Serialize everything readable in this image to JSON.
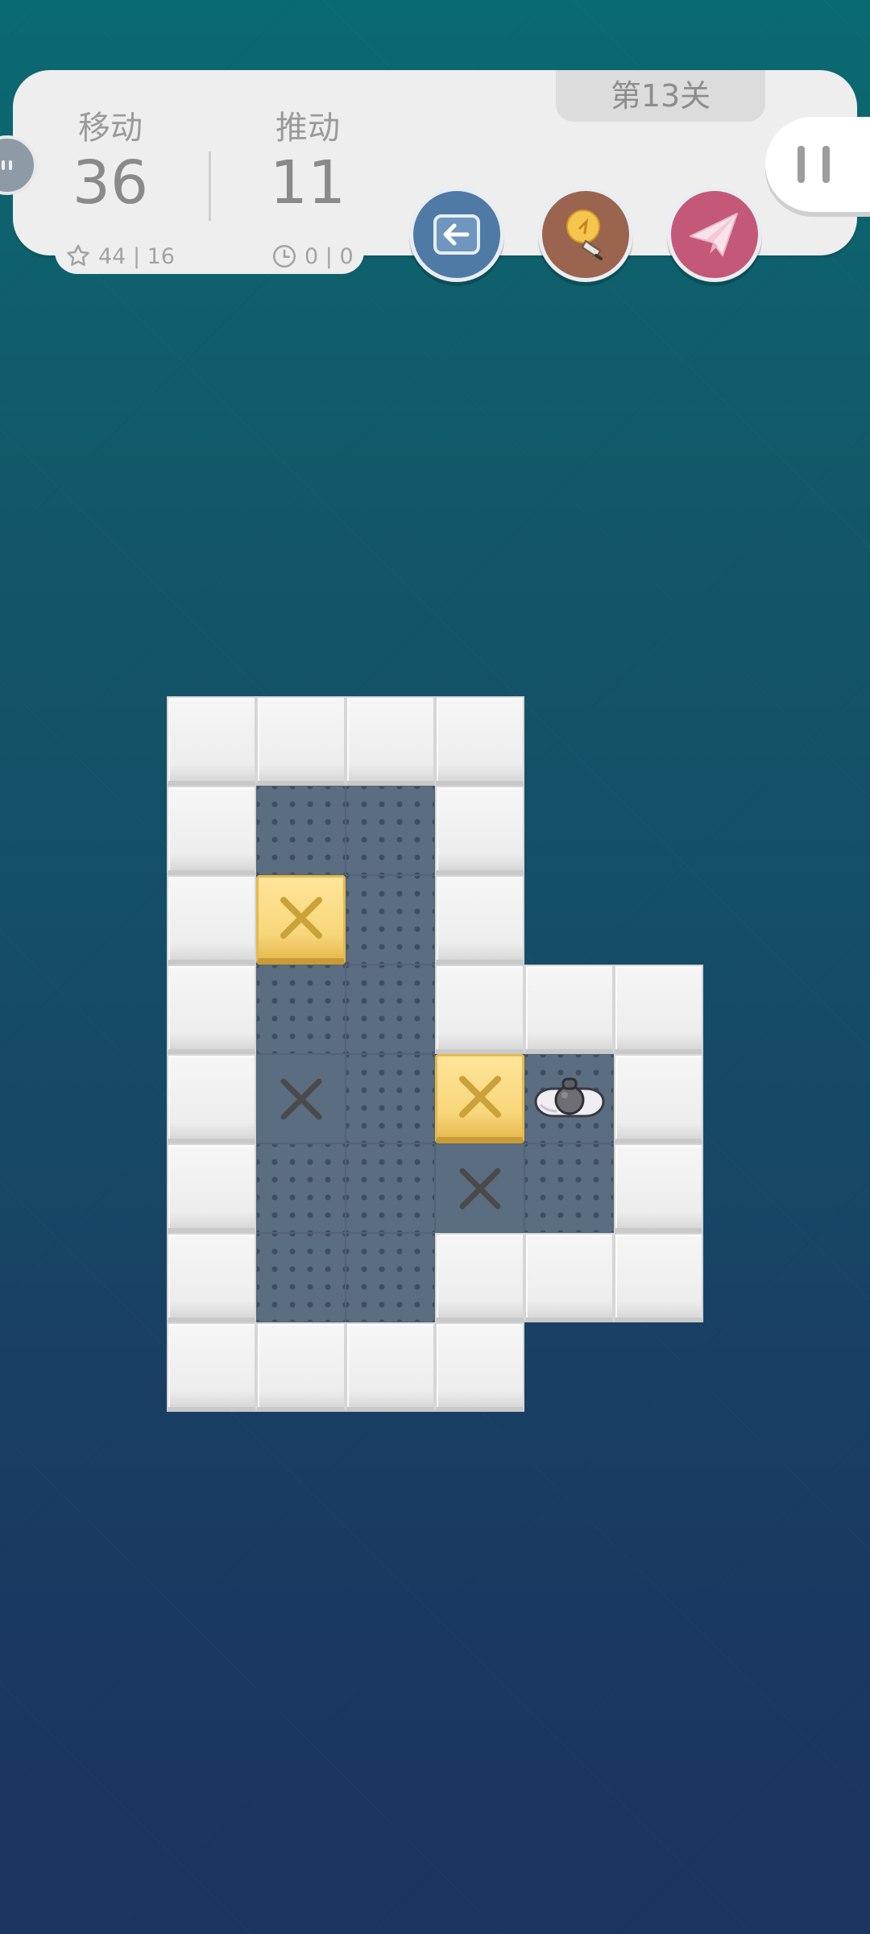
{
  "hud": {
    "moves_label": "移动",
    "moves_value": "36",
    "pushes_label": "推动",
    "pushes_value": "11",
    "best_moves_pushes": "44 | 16",
    "timer": "0 | 0",
    "level_title": "第13关"
  },
  "controls": {
    "undo_icon": "undo-arrow-icon",
    "hint_icon": "lightbulb-icon",
    "share_icon": "paper-plane-icon",
    "pause_icon": "pause-icon"
  },
  "colors": {
    "undo_button": "#4f7aa6",
    "hint_button": "#9a644f",
    "share_button": "#c45878",
    "box": "#f8d67a",
    "floor": "#5b6d80",
    "wall": "#eeeeee"
  },
  "board": {
    "rows": 8,
    "cols": 6,
    "legend": {
      "W": "wall",
      "F": "floor",
      "G": "goal",
      "B": "box",
      "P": "player",
      ".": "empty"
    },
    "grid": [
      "WWWW..",
      "WFFW..",
      "WBFW..",
      "WFFWWW",
      "WGFBPW",
      "WFFGFW",
      "WFFWWW",
      "WWWW.."
    ]
  }
}
